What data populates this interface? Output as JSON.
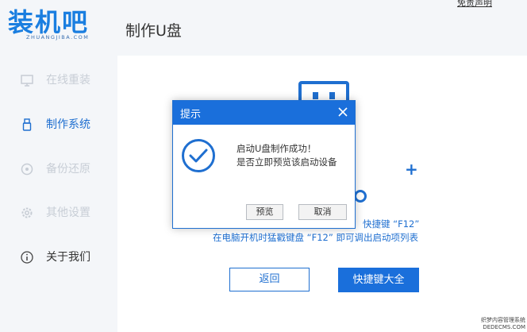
{
  "header": {
    "logo_text": "装机吧",
    "logo_subtext": "ZHUANGJIBA.COM",
    "app_title": "制作U盘",
    "disclaimer": "免责声明"
  },
  "sidebar": {
    "items": [
      {
        "label": "在线重装",
        "icon": "monitor-icon"
      },
      {
        "label": "制作系统",
        "icon": "usb-icon"
      },
      {
        "label": "备份还原",
        "icon": "backup-icon"
      },
      {
        "label": "其他设置",
        "icon": "gear-icon"
      },
      {
        "label": "关于我们",
        "icon": "info-icon"
      }
    ],
    "active_index": 1
  },
  "main": {
    "hint_line1": "快捷键 “F12”",
    "hint_line2": "在电脑开机时猛戳键盘 “F12” 即可调出启动项列表",
    "back_button": "返回",
    "shortcut_button": "快捷键大全"
  },
  "dialog": {
    "title": "提示",
    "message_line1": "启动U盘制作成功！",
    "message_line2": "是否立即预览该启动设备",
    "preview_button": "预览",
    "cancel_button": "取消"
  },
  "watermark": {
    "line1": "织梦内容管理系统",
    "line2": "DEDECMS.COM"
  },
  "colors": {
    "accent": "#1a6fdb",
    "sidebar_bg": "#f4f6f9",
    "inactive_text": "#c8ced6"
  }
}
